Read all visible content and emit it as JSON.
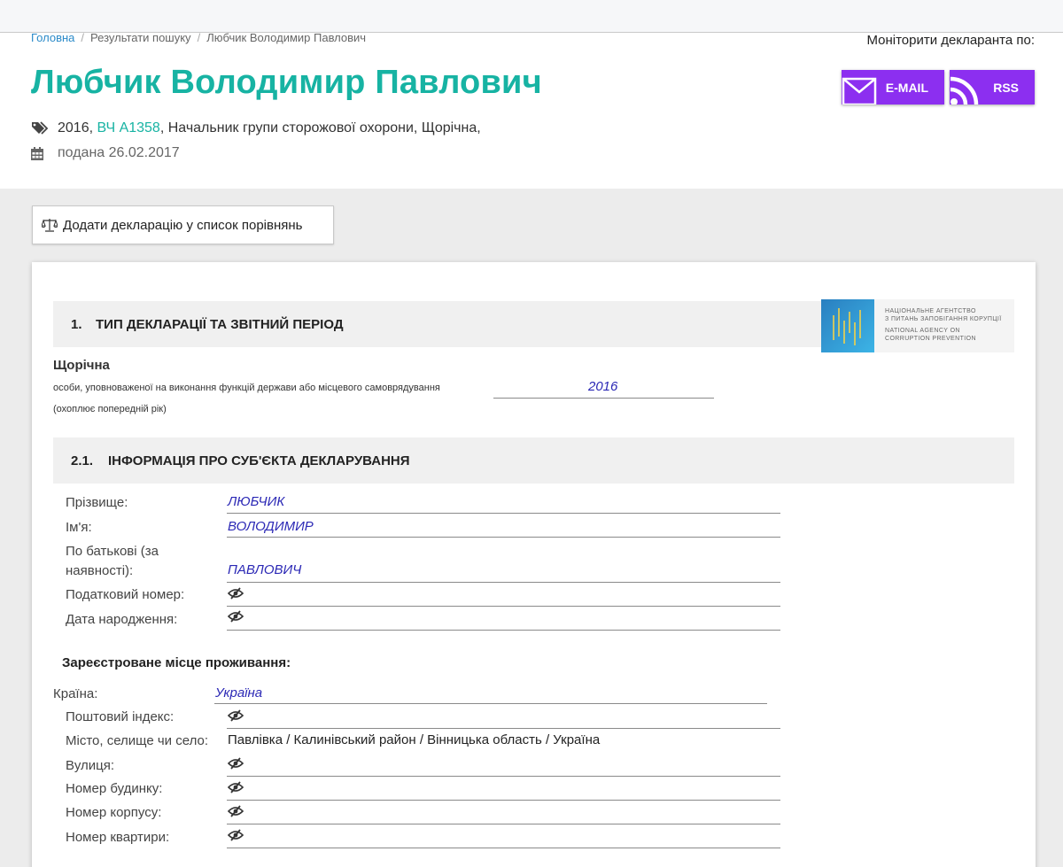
{
  "breadcrumb": {
    "home": "Головна",
    "search": "Результати пошуку",
    "current": "Любчик Володимир Павлович",
    "separator": "/"
  },
  "title": "Любчик Володимир Павлович",
  "meta": {
    "year": "2016,",
    "unit_link": "ВЧ А1358",
    "position": ", Начальник групи сторожової охорони, Щорічна,",
    "submitted": "подана 26.02.2017"
  },
  "monitor": {
    "label": "Моніторити декларанта по:",
    "email": "E-MAIL",
    "rss": "RSS"
  },
  "compare_button": "Додати декларацію у список порівнянь",
  "logo": {
    "line1": "НАЦІОНАЛЬНЕ АГЕНТСТВО",
    "line2": "З ПИТАНЬ ЗАПОБІГАННЯ КОРУПЦІЇ",
    "line3": "NATIONAL AGENCY ON",
    "line4": "CORRUPTION PREVENTION"
  },
  "section1": {
    "number": "1.",
    "title": "ТИП ДЕКЛАРАЦІЇ ТА ЗВІТНИЙ ПЕРІОД",
    "type": "Щорічна",
    "note1": "особи, уповноваженої на виконання функцій держави або місцевого самоврядування",
    "note2": "(охоплює попередній рік)",
    "year": "2016"
  },
  "section2": {
    "number": "2.1.",
    "title": "ІНФОРМАЦІЯ ПРО СУБ'ЄКТА ДЕКЛАРУВАННЯ",
    "surname_label": "Прізвище:",
    "surname": "ЛЮБЧИК",
    "name_label": "Ім'я:",
    "name": "ВОЛОДИМИР",
    "patronymic_label_1": "По батькові (за",
    "patronymic_label_2": "наявності):",
    "patronymic": "ПАВЛОВИЧ",
    "tax_label": "Податковий номер:",
    "dob_label": "Дата народження:"
  },
  "residence": {
    "heading": "Зареєстроване місце проживання:",
    "country_label": "Країна:",
    "country": "Україна",
    "postal_label": "Поштовий індекс:",
    "city_label": "Місто, селище чи село:",
    "city": "Павлівка / Калинівський район / Вінницька область / Україна",
    "street_label": "Вулиця:",
    "house_label": "Номер будинку:",
    "building_label": "Номер корпусу:",
    "apartment_label": "Номер квартири:"
  },
  "colors": {
    "title_teal": "#17b3a3",
    "link_blue": "#2a8ac9",
    "button_purple": "#8c2ff0",
    "value_blue": "#2b28b5"
  },
  "icons": {
    "tags": "tags-icon",
    "calendar": "calendar-icon",
    "email": "envelope-icon",
    "rss": "rss-icon",
    "scale": "scale-icon",
    "hidden": "eye-slash-icon"
  }
}
